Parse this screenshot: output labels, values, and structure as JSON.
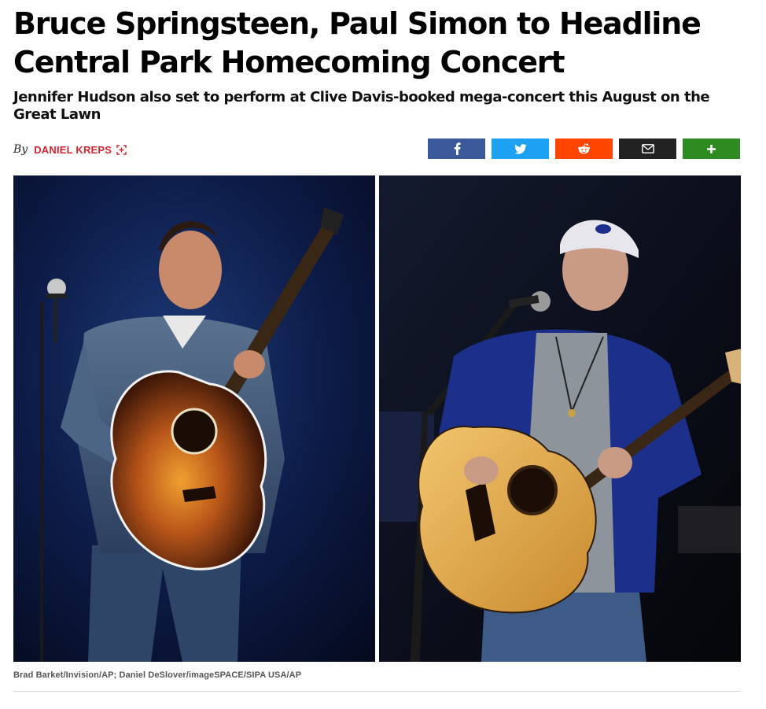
{
  "article": {
    "title_line1": "Bruce Springsteen, Paul Simon to Headline",
    "title_line2": "Central Park Homecoming Concert",
    "subtitle": "Jennifer Hudson also set to perform at Clive Davis-booked mega-concert this August on the Great Lawn",
    "byline_prefix": "By",
    "author": "DANIEL KREPS",
    "photo_credit": "Brad Barket/Invision/AP; Daniel DeSlover/imageSPACE/SIPA USA/AP"
  },
  "share_buttons": [
    {
      "name": "facebook",
      "icon": "facebook-icon",
      "color": "#3b5998"
    },
    {
      "name": "twitter",
      "icon": "twitter-icon",
      "color": "#1da1f2"
    },
    {
      "name": "reddit",
      "icon": "reddit-icon",
      "color": "#ff4500"
    },
    {
      "name": "email",
      "icon": "mail-icon",
      "color": "#222222"
    },
    {
      "name": "more",
      "icon": "plus-icon",
      "color": "#2e8b21"
    }
  ],
  "photos": [
    {
      "subject": "Bruce Springsteen with acoustic guitar",
      "background": "#0a1430"
    },
    {
      "subject": "Paul Simon with acoustic guitar",
      "background": "#0b0f1a"
    }
  ],
  "colors": {
    "author": "#d32531",
    "text": "#000000",
    "divider": "#d8d8d8"
  }
}
